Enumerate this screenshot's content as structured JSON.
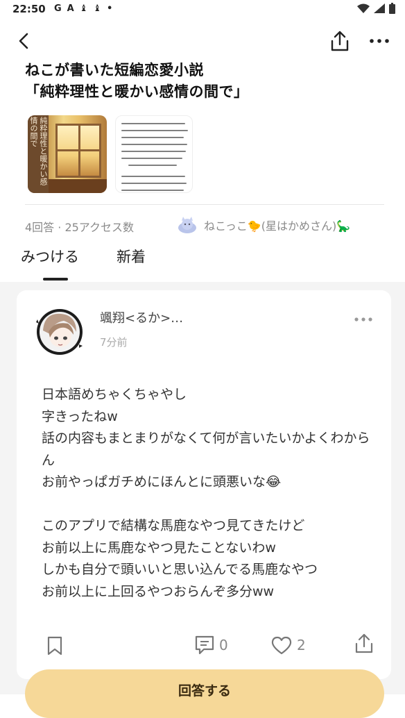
{
  "status_bar": {
    "time": "22:50",
    "app_icons": [
      "G",
      "A",
      "♝",
      "♝",
      "•"
    ],
    "signal_icons": [
      "wifi-icon",
      "signal-icon",
      "battery-icon"
    ]
  },
  "header": {
    "back_icon": "chevron-left-icon",
    "share_icon": "share-icon",
    "more_icon": "more-horizontal-icon"
  },
  "post": {
    "title_line1": "ねこが書いた短編恋愛小説",
    "title_line2": "「純粋理性と暖かい感情の間で」",
    "thumbnail1_vertical_text": "純粋理性と暖かい感情の間で",
    "answers_and_views": "4回答 · 25アクセス数",
    "author_name": "ねこっこ🐤(星はかめさん)🦕"
  },
  "tabs": [
    {
      "label": "みつける",
      "active": true
    },
    {
      "label": "新着",
      "active": false
    }
  ],
  "answer": {
    "username": "颯翔<るか>…",
    "time_ago": "7分前",
    "body": "日本語めちゃくちゃやし\n字きったねw\n話の内容もまとまりがなくて何が言いたいかよくわからん\nお前やっぱガチめにほんとに頭悪いな😂\n\nこのアプリで結構な馬鹿なやつ見てきたけど\nお前以上に馬鹿なやつ見たことないわw\nしかも自分で頭いいと思い込んでる馬鹿なやつ\nお前以上に上回るやつおらんぞ多分ww",
    "comment_count": "0",
    "like_count": "2"
  },
  "answer_button": {
    "label": "回答する"
  },
  "colors": {
    "accent_button": "#f6d898",
    "feed_background": "#f4f4f4",
    "text_muted": "#8a8a8a"
  }
}
